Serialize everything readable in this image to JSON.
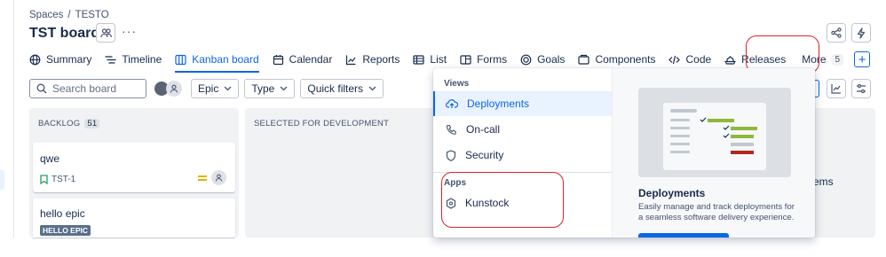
{
  "breadcrumb": {
    "spaces": "Spaces",
    "separator": "/",
    "project": "TESTO"
  },
  "board": {
    "title": "TST board",
    "more_menu": "···"
  },
  "tabs": [
    {
      "label": "Summary",
      "icon": "globe-icon"
    },
    {
      "label": "Timeline",
      "icon": "timeline-icon"
    },
    {
      "label": "Kanban board",
      "icon": "board-icon",
      "active": true
    },
    {
      "label": "Calendar",
      "icon": "calendar-icon"
    },
    {
      "label": "Reports",
      "icon": "chart-line-icon"
    },
    {
      "label": "List",
      "icon": "list-icon"
    },
    {
      "label": "Forms",
      "icon": "form-icon"
    },
    {
      "label": "Goals",
      "icon": "target-icon"
    },
    {
      "label": "Components",
      "icon": "component-icon"
    },
    {
      "label": "Code",
      "icon": "code-icon"
    },
    {
      "label": "Releases",
      "icon": "ship-icon"
    }
  ],
  "more_tab": {
    "label": "More",
    "count": "5",
    "add": "+"
  },
  "toolbar": {
    "search_placeholder": "Search board",
    "epic": "Epic",
    "type": "Type",
    "quick_filters": "Quick filters"
  },
  "columns": [
    {
      "title": "BACKLOG",
      "count": "51"
    },
    {
      "title": "SELECTED FOR DEVELOPMENT"
    }
  ],
  "cards": [
    {
      "title": "qwe",
      "key": "TST-1"
    },
    {
      "title": "hello epic",
      "epic": "HELLO EPIC"
    }
  ],
  "right_partial_text": "ems",
  "dropdown": {
    "views_heading": "Views",
    "views": [
      {
        "label": "Deployments",
        "icon": "cloud-upload-icon",
        "selected": true
      },
      {
        "label": "On-call",
        "icon": "phone-icon"
      },
      {
        "label": "Security",
        "icon": "shield-icon"
      }
    ],
    "apps_heading": "Apps",
    "apps": [
      {
        "label": "Kunstock",
        "icon": "hexagon-icon"
      }
    ],
    "preview": {
      "title": "Deployments",
      "description": "Easily manage and track deployments for a seamless software delivery experience."
    }
  },
  "colors": {
    "accent": "#0c66e4",
    "highlight_outline": "#e0202a",
    "epic_badge": "#5a6f8a"
  }
}
